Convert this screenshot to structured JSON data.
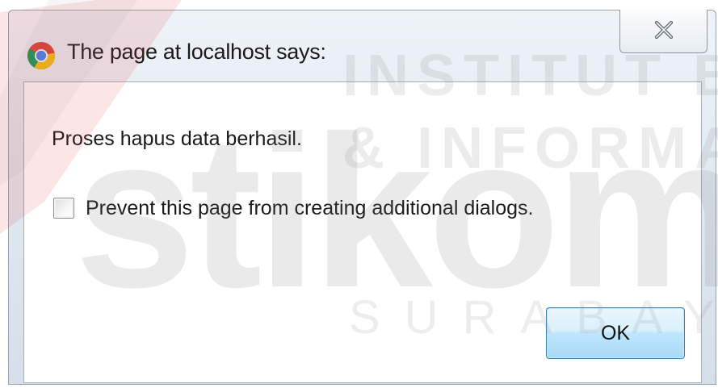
{
  "dialog": {
    "title": "The page at localhost says:",
    "message": "Proses hapus data berhasil.",
    "checkbox_label": "Prevent this page from creating additional dialogs.",
    "checkbox_checked": false,
    "ok_label": "OK",
    "close_icon": "close-icon",
    "app_icon": "chrome-icon"
  },
  "watermark": {
    "line1": "INSTITUT BISNIS",
    "line2": "& INFORMATIKA",
    "brand": "stikom",
    "city": "SURABAYA",
    "accent_color": "#e0373c"
  }
}
